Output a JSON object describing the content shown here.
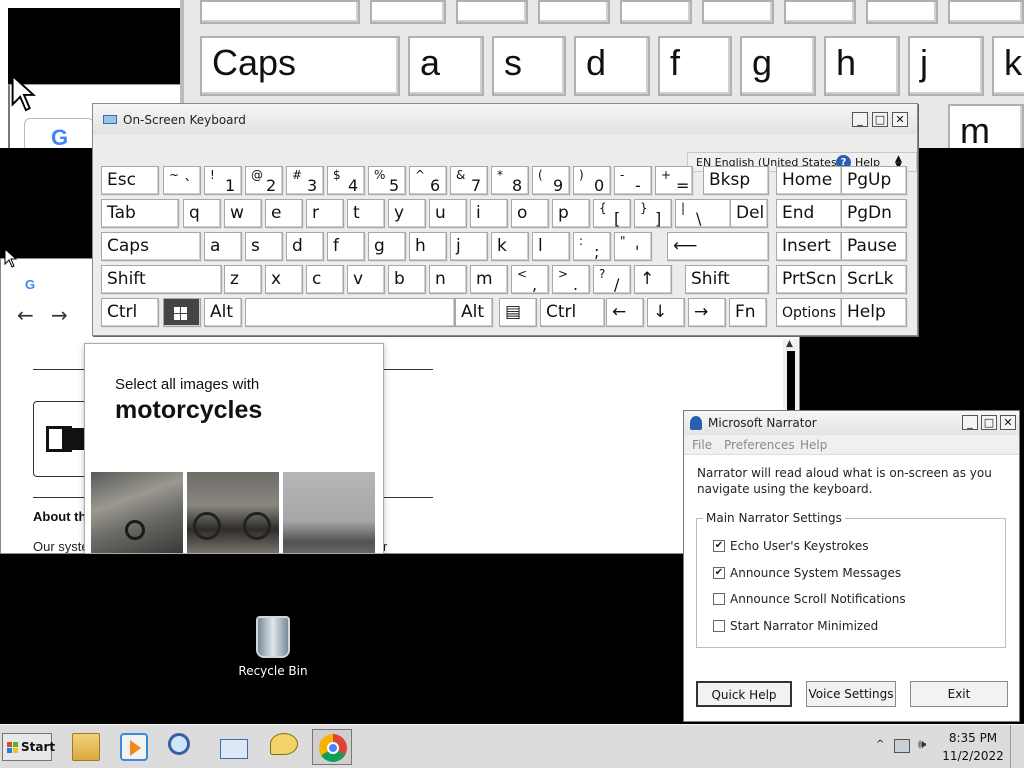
{
  "magnifier": {
    "keys": [
      {
        "label": "Caps"
      },
      {
        "label": "a"
      },
      {
        "label": "s"
      },
      {
        "label": "d"
      },
      {
        "label": "f"
      },
      {
        "label": "g"
      },
      {
        "label": "h"
      },
      {
        "label": "j"
      },
      {
        "label": "k"
      },
      {
        "label": "m"
      }
    ]
  },
  "browser": {
    "tab_logo": "G",
    "about_title": "About th",
    "about_text": "Our syste",
    "about_text_end": "r"
  },
  "captcha": {
    "prompt": "Select all images with",
    "target": "motorcycles"
  },
  "osk": {
    "title": "On-Screen Keyboard",
    "language": "EN English (United States)",
    "help_label": "Help",
    "minimize": "_",
    "maximize": "□",
    "close": "✕",
    "rows": [
      [
        {
          "n": "key-esc",
          "l": "Esc"
        },
        {
          "n": "key-tilde",
          "s": "~",
          "b": "`"
        },
        {
          "n": "key-1",
          "s": "!",
          "b": "1"
        },
        {
          "n": "key-2",
          "s": "@",
          "b": "2"
        },
        {
          "n": "key-3",
          "s": "#",
          "b": "3"
        },
        {
          "n": "key-4",
          "s": "$",
          "b": "4"
        },
        {
          "n": "key-5",
          "s": "%",
          "b": "5"
        },
        {
          "n": "key-6",
          "s": "^",
          "b": "6"
        },
        {
          "n": "key-7",
          "s": "&",
          "b": "7"
        },
        {
          "n": "key-8",
          "s": "*",
          "b": "8"
        },
        {
          "n": "key-9",
          "s": "(",
          "b": "9"
        },
        {
          "n": "key-0",
          "s": ")",
          "b": "0"
        },
        {
          "n": "key-minus",
          "s": "-",
          "b": "-"
        },
        {
          "n": "key-equals",
          "s": "+",
          "b": "="
        },
        {
          "n": "key-backspace",
          "l": "Bksp"
        },
        {
          "n": "key-home",
          "l": "Home"
        },
        {
          "n": "key-pgup",
          "l": "PgUp"
        }
      ],
      [
        {
          "n": "key-tab",
          "l": "Tab"
        },
        {
          "n": "key-q",
          "l": "q"
        },
        {
          "n": "key-w",
          "l": "w"
        },
        {
          "n": "key-e",
          "l": "e"
        },
        {
          "n": "key-r",
          "l": "r"
        },
        {
          "n": "key-t",
          "l": "t"
        },
        {
          "n": "key-y",
          "l": "y"
        },
        {
          "n": "key-u",
          "l": "u"
        },
        {
          "n": "key-i",
          "l": "i"
        },
        {
          "n": "key-o",
          "l": "o"
        },
        {
          "n": "key-p",
          "l": "p"
        },
        {
          "n": "key-lbracket",
          "s": "{",
          "b": "["
        },
        {
          "n": "key-rbracket",
          "s": "}",
          "b": "]"
        },
        {
          "n": "key-backslash",
          "s": "|",
          "b": "\\"
        },
        {
          "n": "key-del",
          "l": "Del"
        },
        {
          "n": "key-end",
          "l": "End"
        },
        {
          "n": "key-pgdn",
          "l": "PgDn"
        }
      ],
      [
        {
          "n": "key-caps",
          "l": "Caps"
        },
        {
          "n": "key-a",
          "l": "a"
        },
        {
          "n": "key-s",
          "l": "s"
        },
        {
          "n": "key-d",
          "l": "d"
        },
        {
          "n": "key-f",
          "l": "f"
        },
        {
          "n": "key-g",
          "l": "g"
        },
        {
          "n": "key-h",
          "l": "h"
        },
        {
          "n": "key-j",
          "l": "j"
        },
        {
          "n": "key-k",
          "l": "k"
        },
        {
          "n": "key-l",
          "l": "l"
        },
        {
          "n": "key-semicolon",
          "s": ":",
          "b": ";"
        },
        {
          "n": "key-quote",
          "s": "\"",
          "b": "'"
        },
        {
          "n": "key-enter",
          "l": "⟵"
        },
        {
          "n": "key-insert",
          "l": "Insert"
        },
        {
          "n": "key-pause",
          "l": "Pause"
        }
      ],
      [
        {
          "n": "key-shift-left",
          "l": "Shift"
        },
        {
          "n": "key-z",
          "l": "z"
        },
        {
          "n": "key-x",
          "l": "x"
        },
        {
          "n": "key-c",
          "l": "c"
        },
        {
          "n": "key-v",
          "l": "v"
        },
        {
          "n": "key-b",
          "l": "b"
        },
        {
          "n": "key-n",
          "l": "n"
        },
        {
          "n": "key-m",
          "l": "m"
        },
        {
          "n": "key-comma",
          "s": "<",
          "b": ","
        },
        {
          "n": "key-period",
          "s": ">",
          "b": "."
        },
        {
          "n": "key-slash",
          "s": "?",
          "b": "/"
        },
        {
          "n": "key-up",
          "l": "↑"
        },
        {
          "n": "key-shift-right",
          "l": "Shift"
        },
        {
          "n": "key-prtscn",
          "l": "PrtScn"
        },
        {
          "n": "key-scrlk",
          "l": "ScrLk"
        }
      ],
      [
        {
          "n": "key-ctrl-left",
          "l": "Ctrl"
        },
        {
          "n": "key-win",
          "l": ""
        },
        {
          "n": "key-alt-left",
          "l": "Alt"
        },
        {
          "n": "key-space",
          "l": ""
        },
        {
          "n": "key-alt-right",
          "l": "Alt"
        },
        {
          "n": "key-menu",
          "l": "▤"
        },
        {
          "n": "key-ctrl-right",
          "l": "Ctrl"
        },
        {
          "n": "key-left",
          "l": "←"
        },
        {
          "n": "key-down",
          "l": "↓"
        },
        {
          "n": "key-right",
          "l": "→"
        },
        {
          "n": "key-fn",
          "l": "Fn"
        },
        {
          "n": "key-options",
          "l": "Options"
        },
        {
          "n": "key-help",
          "l": "Help"
        }
      ]
    ]
  },
  "narrator": {
    "title": "Microsoft Narrator",
    "menu": [
      "File",
      "Preferences",
      "Help"
    ],
    "description": "Narrator will read aloud what is on-screen as you navigate using the keyboard.",
    "group_title": "Main Narrator Settings",
    "options": [
      {
        "label": "Echo User's Keystrokes",
        "checked": true,
        "mark": "✔"
      },
      {
        "label": "Announce System Messages",
        "checked": true,
        "mark": "✔"
      },
      {
        "label": "Announce Scroll Notifications",
        "checked": false,
        "mark": ""
      },
      {
        "label": "Start Narrator Minimized",
        "checked": false,
        "mark": ""
      }
    ],
    "buttons": {
      "quick_help": "Quick Help",
      "voice_settings": "Voice Settings",
      "exit": "Exit"
    },
    "minimize": "_",
    "maximize": "□",
    "close": "✕"
  },
  "desktop": {
    "recycle_bin": "Recycle Bin"
  },
  "taskbar": {
    "start_label": "Start",
    "tray_up": "^",
    "volume": "🕪",
    "clock_time": "8:35 PM",
    "clock_date": "11/2/2022"
  },
  "colors": {
    "desktop_bg": "#000000",
    "taskbar_bg": "#dcdcdc",
    "window_chrome": "#ececec",
    "key_face": "#ffffff",
    "active_key": "#444444"
  }
}
